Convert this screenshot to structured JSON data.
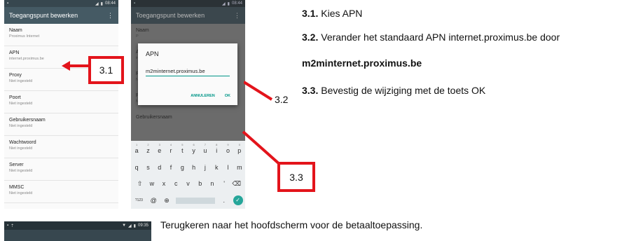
{
  "phone1": {
    "status_time": "08:44",
    "title": "Toegangspunt bewerken",
    "menu_icon": "more-vert-icon",
    "items": [
      {
        "title": "Naam",
        "sub": "Proximus Internet"
      },
      {
        "title": "APN",
        "sub": "internet.proximus.be"
      },
      {
        "title": "Proxy",
        "sub": "Niet ingesteld"
      },
      {
        "title": "Poort",
        "sub": "Niet ingesteld"
      },
      {
        "title": "Gebruikersnaam",
        "sub": "Niet ingesteld"
      },
      {
        "title": "Wachtwoord",
        "sub": "Niet ingesteld"
      },
      {
        "title": "Server",
        "sub": "Niet ingesteld"
      },
      {
        "title": "MMSC",
        "sub": "Niet ingesteld"
      }
    ]
  },
  "phone2": {
    "status_time": "08:44",
    "title": "Toegangspunt bewerken",
    "bg_items": [
      {
        "title": "Naam",
        "sub": "P"
      },
      {
        "title": "A",
        "sub": "ir"
      },
      {
        "title": "P",
        "sub": "N"
      },
      {
        "title": "Poort",
        "sub": "Niet ingesteld"
      },
      {
        "title": "Gebruikersnaam",
        "sub": ""
      }
    ],
    "dialog": {
      "title": "APN",
      "value": "m2minternet.proximus.be",
      "cancel": "ANNULEREN",
      "ok": "OK"
    },
    "keyboard": {
      "row1": [
        "a",
        "z",
        "e",
        "r",
        "t",
        "y",
        "u",
        "i",
        "o",
        "p"
      ],
      "row1_hints": [
        "1",
        "2",
        "3",
        "4",
        "5",
        "6",
        "7",
        "8",
        "9",
        "0"
      ],
      "row2": [
        "q",
        "s",
        "d",
        "f",
        "g",
        "h",
        "j",
        "k",
        "l",
        "m"
      ],
      "row3": [
        "w",
        "x",
        "c",
        "v",
        "b",
        "n",
        "'"
      ],
      "row4_symbols": "?123",
      "row4_at": "@",
      "row4_period": "."
    }
  },
  "callouts": {
    "c31": "3.1",
    "c32": "3.2",
    "c33": "3.3"
  },
  "instructions": {
    "step1_num": "3.1.",
    "step1_text": " Kies APN",
    "step2_num": "3.2.",
    "step2_text": " Verander het standaard APN internet.proximus.be door",
    "step2_value": "m2minternet.proximus.be",
    "step3_num": "3.3.",
    "step3_text": " Bevestig de wijziging met de toets OK",
    "return_text": "Terugkeren naar het hoofdscherm voor de betaaltoepassing."
  },
  "phone3": {
    "status_time": "09:35"
  },
  "colors": {
    "callout_red": "#e3141b",
    "appbar": "#455a64",
    "accent": "#009688"
  }
}
